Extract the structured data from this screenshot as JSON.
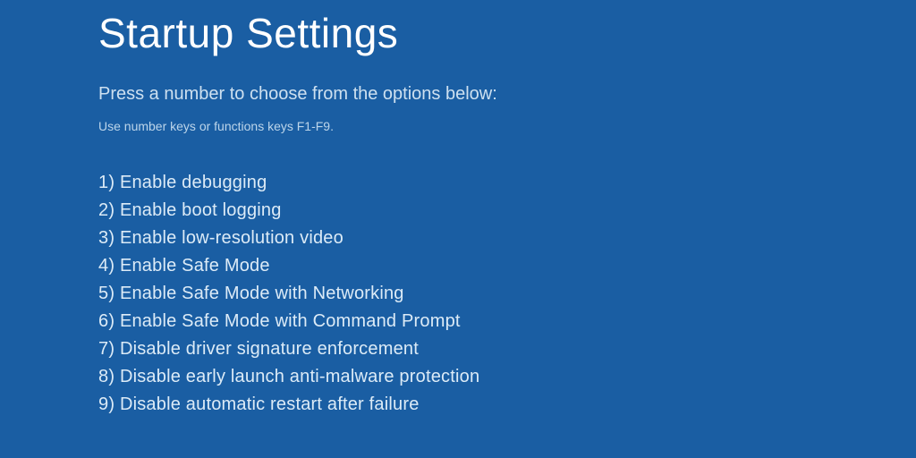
{
  "title": "Startup Settings",
  "subtitle": "Press a number to choose from the options below:",
  "hint": "Use number keys or functions keys F1-F9.",
  "options": [
    "1) Enable debugging",
    "2) Enable boot logging",
    "3) Enable low-resolution video",
    "4) Enable Safe Mode",
    "5) Enable Safe Mode with Networking",
    "6) Enable Safe Mode with Command Prompt",
    "7) Disable driver signature enforcement",
    "8) Disable early launch anti-malware protection",
    "9) Disable automatic restart after failure"
  ]
}
